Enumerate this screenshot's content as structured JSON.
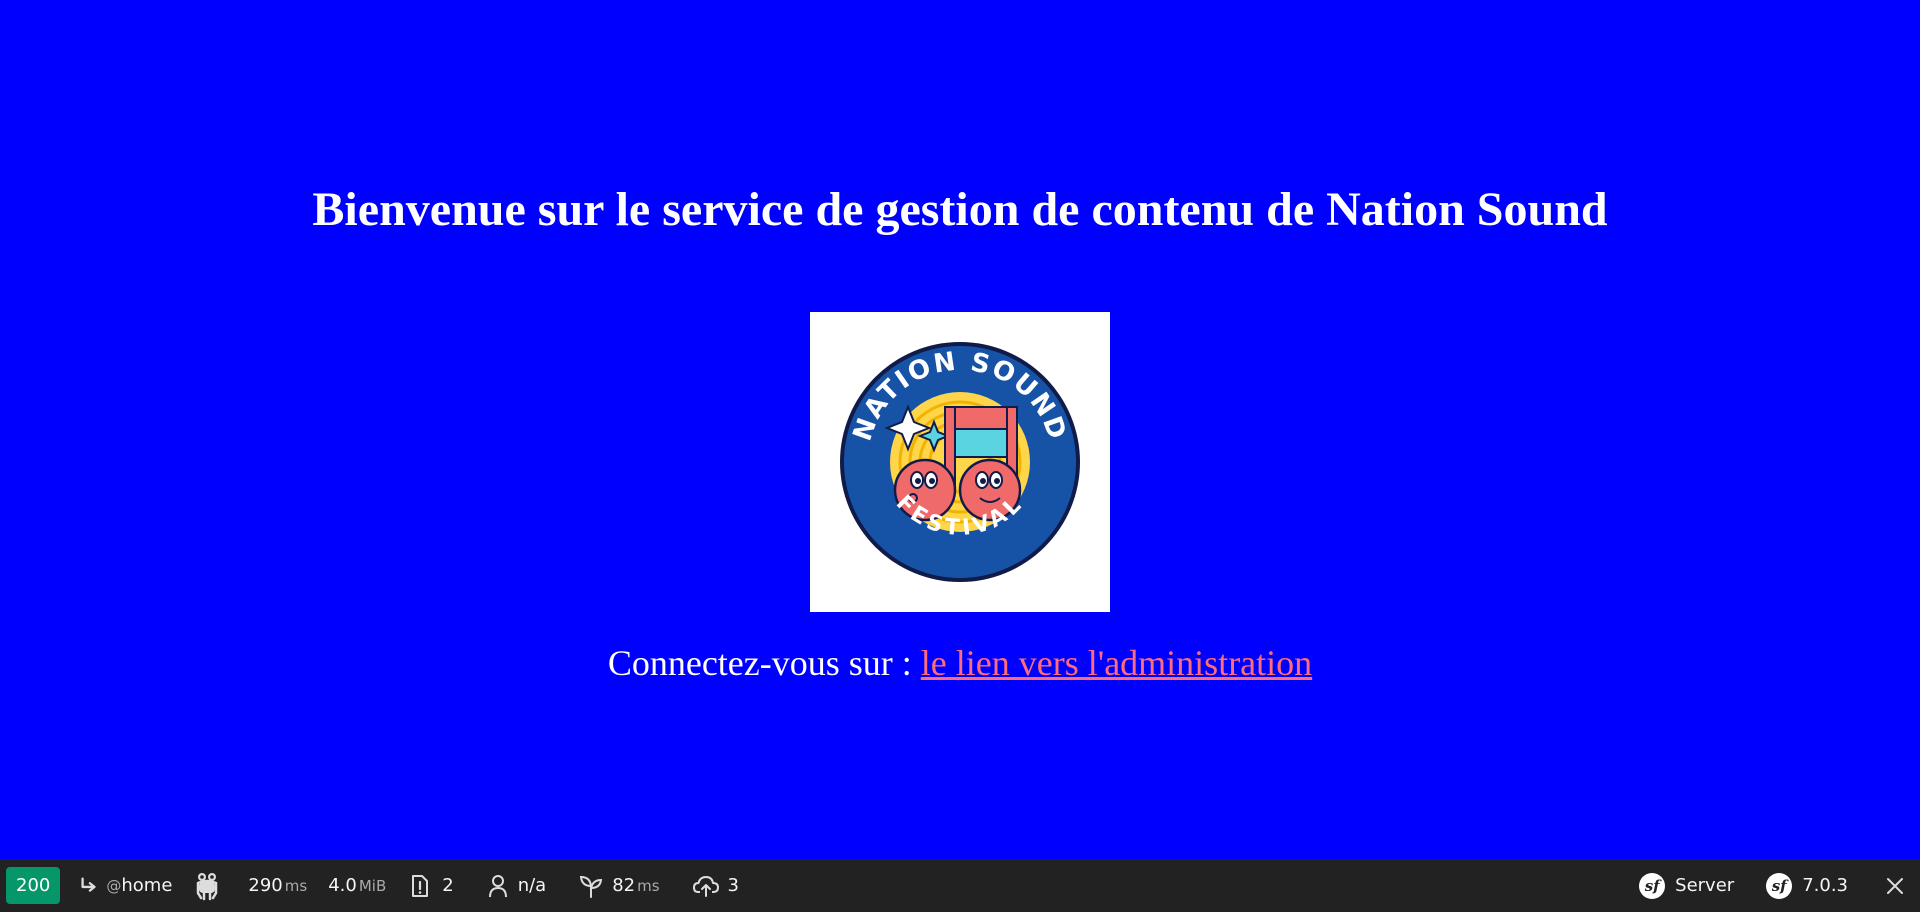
{
  "page": {
    "title": "Bienvenue sur le service de gestion de contenu de Nation Sound",
    "logo": {
      "top_text": "NATION SOUND",
      "bottom_text": "FESTIVAL",
      "colors": {
        "ring": "#1653a6",
        "note": "#f06a6a",
        "accent": "#ffd54a",
        "cyan": "#5ad4e0"
      }
    },
    "connect_text": "Connectez-vous sur :",
    "admin_link": "le lien vers l'administration"
  },
  "toolbar": {
    "status_code": "200",
    "route_prefix": "@",
    "route": "home",
    "time_value": "290",
    "time_unit": "ms",
    "memory_value": "4.0",
    "memory_unit": "MiB",
    "logs_count": "2",
    "user": "n/a",
    "twig_value": "82",
    "twig_unit": "ms",
    "http_count": "3",
    "server_label": "Server",
    "symfony_version": "7.0.3",
    "status_color": "#059669"
  }
}
